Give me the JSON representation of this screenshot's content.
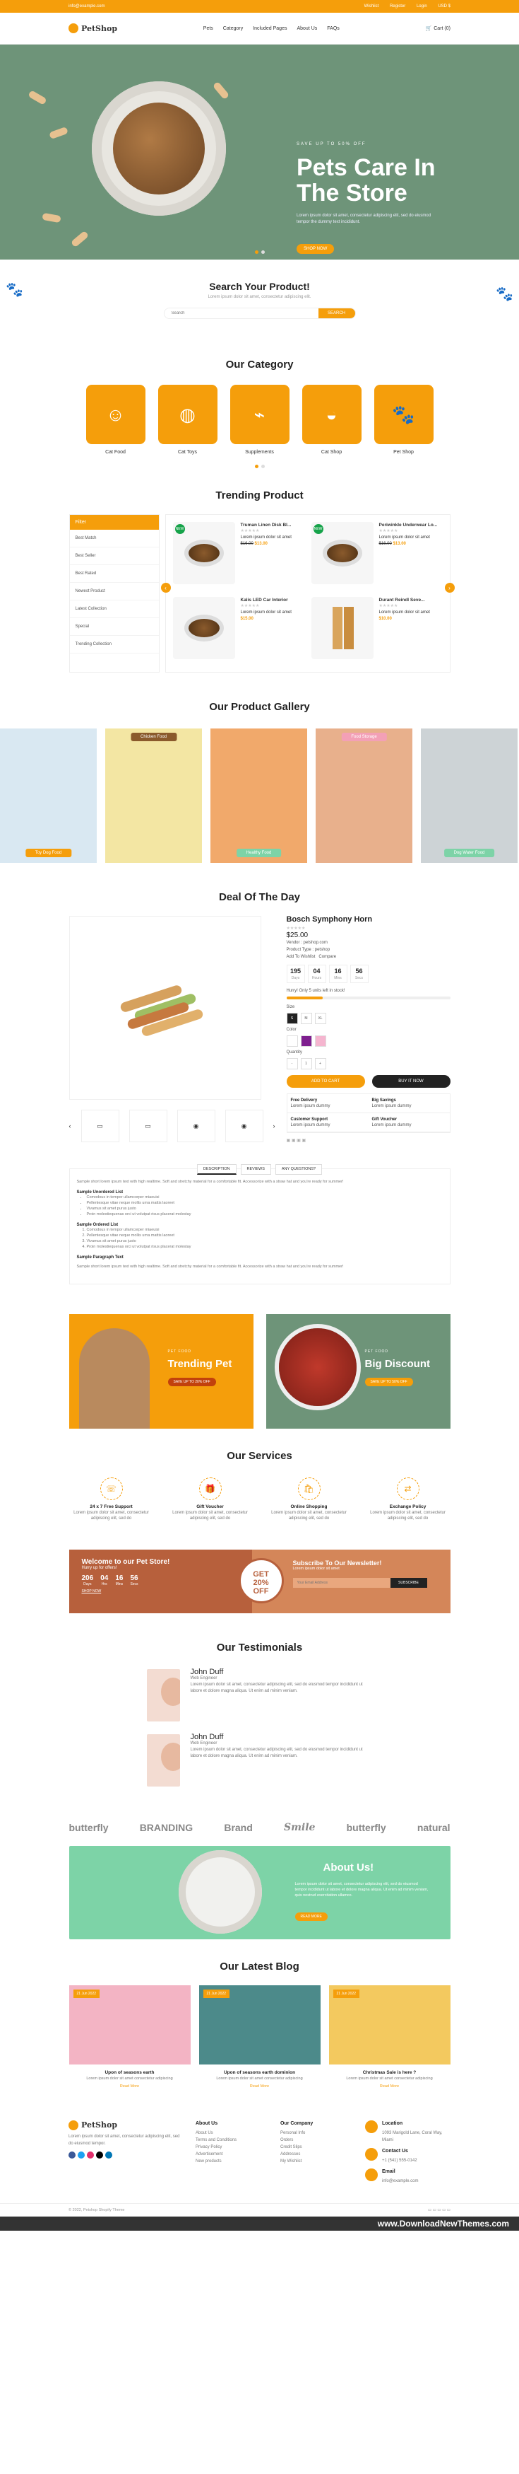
{
  "topbar": {
    "email": "info@example.com",
    "links": [
      "Wishlist",
      "Register",
      "Login",
      "USD $"
    ]
  },
  "header": {
    "logo": "PetShop",
    "menu": [
      "Pets",
      "Category",
      "Included Pages",
      "About Us",
      "FAQs"
    ],
    "cart": "Cart (0)"
  },
  "hero": {
    "kicker": "SAVE UP TO 50% OFF",
    "title": "Pets Care In The Store",
    "text": "Lorem ipsum dolor sit amet, consectetur adipiscing elit, sed do eiusmod tempor the dummy text incididunt.",
    "button": "SHOP NOW"
  },
  "search": {
    "title": "Search Your Product!",
    "subtitle": "Lorem ipsum dolor sit amet, consectetur adipiscing elit.",
    "placeholder": "Search",
    "button": "SEARCH"
  },
  "category": {
    "title": "Our Category",
    "items": [
      {
        "label": "Cat Food",
        "icon": "cat-food-icon"
      },
      {
        "label": "Cat Toys",
        "icon": "yarn-ball-icon"
      },
      {
        "label": "Supplements",
        "icon": "bone-icon"
      },
      {
        "label": "Cat Shop",
        "icon": "pet-bowl-icon"
      },
      {
        "label": "Pet Shop",
        "icon": "paw-icon"
      }
    ]
  },
  "trending": {
    "title": "Trending Product",
    "filter_title": "Filter",
    "filters": [
      "Best Match",
      "Best Seller",
      "Best Rated",
      "Newest Product",
      "Latest Collection",
      "Special",
      "Trending Collection"
    ],
    "products": [
      {
        "name": "Truman Linen Disk Bl...",
        "price": "$13.00",
        "old": "$16.00"
      },
      {
        "name": "Periwinkle Underwear Lo...",
        "price": "$13.00",
        "old": "$16.00"
      },
      {
        "name": "Kalis LED Car Interior",
        "price": "$15.00",
        "old": ""
      },
      {
        "name": "Durant Reindl Seve...",
        "price": "$10.00",
        "old": ""
      }
    ]
  },
  "gallery": {
    "title": "Our Product Gallery",
    "labels": [
      "Toy Dog Food",
      "Chicken Food",
      "Healthy Food",
      "Food Storage",
      "Dog Water Food"
    ]
  },
  "deal": {
    "title": "Deal Of The Day",
    "name": "Bosch Symphony Horn",
    "price": "$25.00",
    "vendor": "Vendor : petshop.com",
    "type": "Product Type : petshop",
    "wish": "Add To Wishlist",
    "compare": "Compare",
    "timer": [
      {
        "v": "195",
        "l": "Days"
      },
      {
        "v": "04",
        "l": "Hours"
      },
      {
        "v": "16",
        "l": "Mins"
      },
      {
        "v": "56",
        "l": "Secs"
      }
    ],
    "stock": "Hurry! Only 5 units left in stock!",
    "size_label": "Size",
    "sizes": [
      "S",
      "M",
      "XL"
    ],
    "color_label": "Color",
    "qty_label": "Quantity",
    "qty": "1",
    "add": "ADD TO CART",
    "buy": "BUY IT NOW",
    "features": [
      {
        "t": "Free Delivery",
        "s": "Lorem ipsum dummy"
      },
      {
        "t": "Big Savings",
        "s": "Lorem ipsum dummy"
      },
      {
        "t": "Customer Support",
        "s": "Lorem ipsum dummy"
      },
      {
        "t": "Gift Voucher",
        "s": "Lorem ipsum dummy"
      }
    ]
  },
  "tabs": {
    "items": [
      "DESCRIPTION",
      "REVIEWS",
      "ANY QUESTIONS?"
    ],
    "intro": "Sample short lorem ipsum text with high realtime. Soft and stretchy material for a comfortable fit. Accessorize with a straw hat and you're ready for summer!",
    "h1": "Sample Unordered List",
    "ul": [
      "Comodous in tempor ullamcorper miaeuisi",
      "Pellentesque vitae neque mollis urna mattis laoreet",
      "Vivamus sit amet purus justo",
      "Proin molestiequenas orci ut volutpat risus placerat molestay"
    ],
    "h2": "Sample Ordered List",
    "ol": [
      "Comodous in tempor ullamcorper miaeuisi",
      "Pellentesque vitae neque mollis urna mattis laoreet",
      "Vivamus sit amet purus justo",
      "Proin molestiequenas orci ut volutpat risus placerat molestay"
    ],
    "h3": "Sample Paragraph Text",
    "para": "Sample short lorem ipsum text with high realtime. Soft and stretchy material for a comfortable fit. Accessorize with a straw hat and you're ready for summer!"
  },
  "banners": [
    {
      "kicker": "PET FOOD",
      "title": "Trending Pet",
      "button": "SAVE UP TO 20% OFF"
    },
    {
      "kicker": "PET FOOD",
      "title": "Big Discount",
      "button": "SAVE UP TO 50% OFF"
    }
  ],
  "services": {
    "title": "Our Services",
    "items": [
      {
        "t": "24 x 7 Free Support",
        "s": "Lorem ipsum dolor sit amet, consectetur adipiscing elit, sed do"
      },
      {
        "t": "Gift Voucher",
        "s": "Lorem ipsum dolor sit amet, consectetur adipiscing elit, sed do"
      },
      {
        "t": "Online Shopping",
        "s": "Lorem ipsum dolor sit amet, consectetur adipiscing elit, sed do"
      },
      {
        "t": "Exchange Policy",
        "s": "Lorem ipsum dolor sit amet, consectetur adipiscing elit, sed do"
      }
    ]
  },
  "welcome": {
    "title": "Welcome to our Pet Store!",
    "sub": "Hurry up for offers!",
    "cd": [
      {
        "v": "206",
        "l": "Days"
      },
      {
        "v": "04",
        "l": "Hrs"
      },
      {
        "v": "16",
        "l": "Mins"
      },
      {
        "v": "56",
        "l": "Secs"
      }
    ],
    "shop": "SHOP NOW",
    "badge1": "GET",
    "badge2": "20%",
    "badge3": "OFF",
    "nl_title": "Subscribe To Our Newsletter!",
    "nl_text": "Lorem ipsum dolor sit amet",
    "nl_placeholder": "Your Email Address",
    "nl_button": "SUBSCRIBE"
  },
  "testimonials": {
    "title": "Our Testimonials",
    "items": [
      {
        "name": "John Duff",
        "role": "Web Engineer",
        "text": "Lorem ipsum dolor sit amet, consectetur adipiscing elit, sed do eiusmod tempor incididunt ut labore et dolore magna aliqua. Ut enim ad minim veniam."
      },
      {
        "name": "John Duff",
        "role": "Web Engineer",
        "text": "Lorem ipsum dolor sit amet, consectetur adipiscing elit, sed do eiusmod tempor incididunt ut labore et dolore magna aliqua. Ut enim ad minim veniam."
      }
    ]
  },
  "brands": [
    "butterfly",
    "BRANDING",
    "Brand",
    "Smile",
    "butterfly",
    "natural"
  ],
  "about": {
    "title": "About Us!",
    "text": "Lorem ipsum dolor sit amet, consectetur adipiscing elit, sed do eiusmod tempor incididunt ut labore et dolore magna aliqua. Ut enim ad minim veniam, quis nostrud exercitation ullamco.",
    "button": "READ MORE"
  },
  "blog": {
    "title": "Our Latest Blog",
    "posts": [
      {
        "date": "21 Jun 2022",
        "title": "Upon of seasons earth",
        "text": "Lorem ipsum dolor sit amet consectetur adipiscing",
        "more": "Read More"
      },
      {
        "date": "21 Jun 2022",
        "title": "Upon of seasons earth dominion",
        "text": "Lorem ipsum dolor sit amet consectetur adipiscing",
        "more": "Read More"
      },
      {
        "date": "21 Jun 2022",
        "title": "Christmas Sale is here ?",
        "text": "Lorem ipsum dolor sit amet consectetur adipiscing",
        "more": "Read More"
      }
    ]
  },
  "footer": {
    "logo": "PetShop",
    "text": "Lorem ipsum dolor sit amet, consectetur adipiscing elit, sed do eiusmod tempor.",
    "about_title": "About Us",
    "about": [
      "About Us",
      "Terms and Conditions",
      "Privacy Policy",
      "Advertisement",
      "New products"
    ],
    "company_title": "Our Company",
    "company": [
      "Personal Info",
      "Orders",
      "Credit Slips",
      "Addresses",
      "My Wishlist"
    ],
    "loc_title": "Location",
    "loc": "1093 Marigold Lane, Coral Way, Miami",
    "contact_title": "Contact Us",
    "contact": "+1 (541) 555-0142",
    "email_title": "Email",
    "email": "info@example.com",
    "copy": "© 2022, Petshop Shopify Theme",
    "download": "www.DownloadNewThemes.com"
  }
}
